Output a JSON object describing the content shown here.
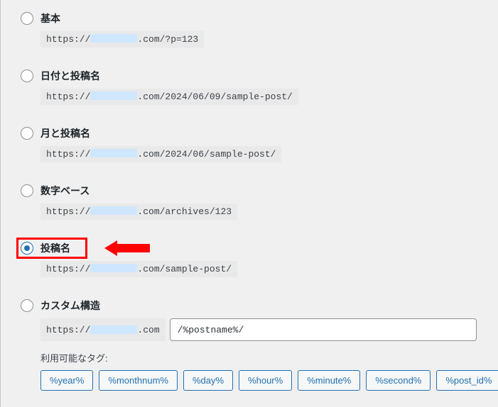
{
  "permalink_options": [
    {
      "key": "plain",
      "label": "基本",
      "url_prefix": "https://",
      "url_suffix": ".com/?p=123",
      "checked": false
    },
    {
      "key": "day-name",
      "label": "日付と投稿名",
      "url_prefix": "https://",
      "url_suffix": ".com/2024/06/09/sample-post/",
      "checked": false
    },
    {
      "key": "month-name",
      "label": "月と投稿名",
      "url_prefix": "https://",
      "url_suffix": ".com/2024/06/sample-post/",
      "checked": false
    },
    {
      "key": "numeric",
      "label": "数字ベース",
      "url_prefix": "https://",
      "url_suffix": ".com/archives/123",
      "checked": false
    },
    {
      "key": "post-name",
      "label": "投稿名",
      "url_prefix": "https://",
      "url_suffix": ".com/sample-post/",
      "checked": true
    },
    {
      "key": "custom",
      "label": "カスタム構造",
      "url_prefix": "https://",
      "url_suffix": ".com",
      "checked": false
    }
  ],
  "custom_structure_value": "/%postname%/",
  "available_tags_label": "利用可能なタグ:",
  "tags": [
    "%year%",
    "%monthnum%",
    "%day%",
    "%hour%",
    "%minute%",
    "%second%",
    "%post_id%"
  ],
  "highlight_index": 4,
  "colors": {
    "accent": "#2271b1",
    "highlight": "#ff0000",
    "mask": "#cfe6ff"
  }
}
